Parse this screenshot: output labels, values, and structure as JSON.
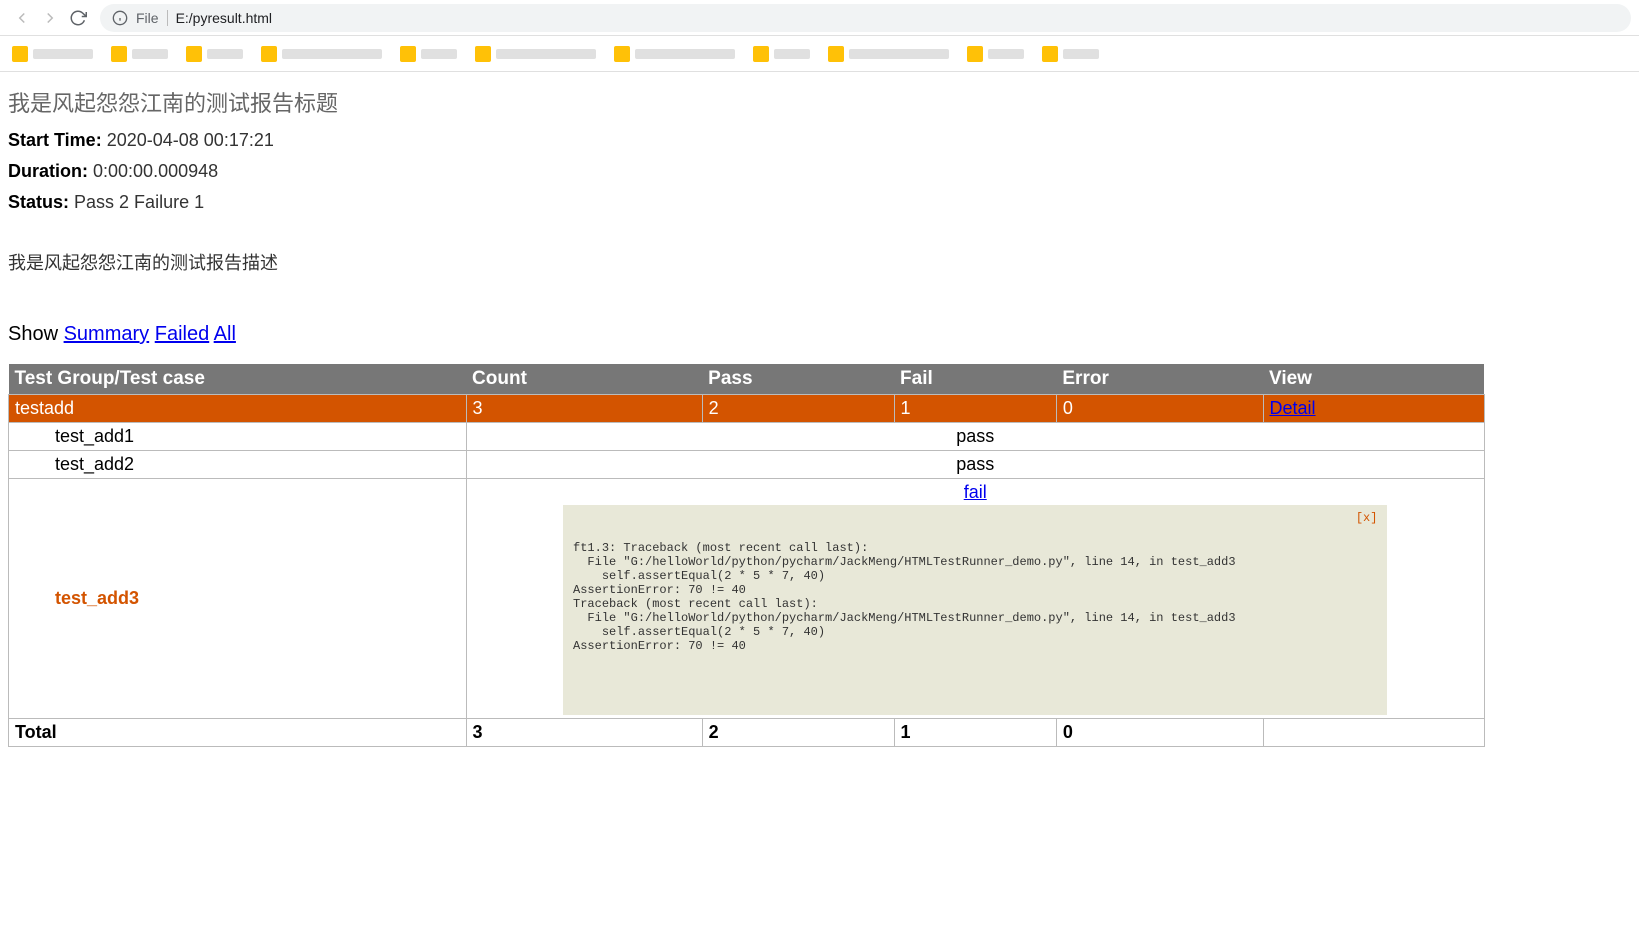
{
  "browser": {
    "file_label": "File",
    "url": "E:/pyresult.html"
  },
  "report": {
    "title": "我是风起怨怨江南的测试报告标题",
    "start_time_label": "Start Time:",
    "start_time": "2020-04-08 00:17:21",
    "duration_label": "Duration:",
    "duration": "0:00:00.000948",
    "status_label": "Status:",
    "status": "Pass 2 Failure 1",
    "description": "我是风起怨怨江南的测试报告描述"
  },
  "filter": {
    "show_label": "Show",
    "summary": "Summary",
    "failed": "Failed",
    "all": "All"
  },
  "table": {
    "headers": {
      "testcase": "Test Group/Test case",
      "count": "Count",
      "pass": "Pass",
      "fail": "Fail",
      "error": "Error",
      "view": "View"
    },
    "group": {
      "name": "testadd",
      "count": "3",
      "pass": "2",
      "fail": "1",
      "error": "0",
      "view": "Detail"
    },
    "rows": [
      {
        "name": "test_add1",
        "result": "pass"
      },
      {
        "name": "test_add2",
        "result": "pass"
      }
    ],
    "fail_row": {
      "name": "test_add3",
      "result": "fail",
      "close": "[x]",
      "traceback": "ft1.3: Traceback (most recent call last):\n  File \"G:/helloWorld/python/pycharm/JackMeng/HTMLTestRunner_demo.py\", line 14, in test_add3\n    self.assertEqual(2 * 5 * 7, 40)\nAssertionError: 70 != 40\nTraceback (most recent call last):\n  File \"G:/helloWorld/python/pycharm/JackMeng/HTMLTestRunner_demo.py\", line 14, in test_add3\n    self.assertEqual(2 * 5 * 7, 40)\nAssertionError: 70 != 40"
    },
    "total": {
      "label": "Total",
      "count": "3",
      "pass": "2",
      "fail": "1",
      "error": "0"
    }
  }
}
